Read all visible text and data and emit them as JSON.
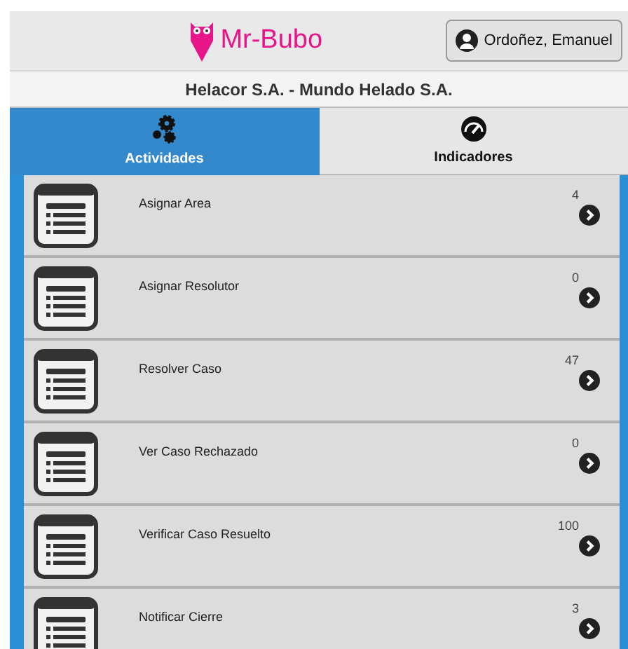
{
  "header": {
    "brand": "Mr-Bubo",
    "user": "Ordoñez, Emanuel"
  },
  "company": "Helacor S.A. - Mundo Helado S.A.",
  "tabs": [
    {
      "label": "Actividades",
      "kind": "gears",
      "selected": true
    },
    {
      "label": "Indicadores",
      "kind": "gauge",
      "selected": false
    }
  ],
  "activities": [
    {
      "name": "Asignar Area",
      "count": "4"
    },
    {
      "name": "Asignar Resolutor",
      "count": "0"
    },
    {
      "name": "Resolver Caso",
      "count": "47"
    },
    {
      "name": "Ver Caso Rechazado",
      "count": "0"
    },
    {
      "name": "Verificar Caso Resuelto",
      "count": "100"
    },
    {
      "name": "Notificar Cierre",
      "count": "3"
    }
  ]
}
